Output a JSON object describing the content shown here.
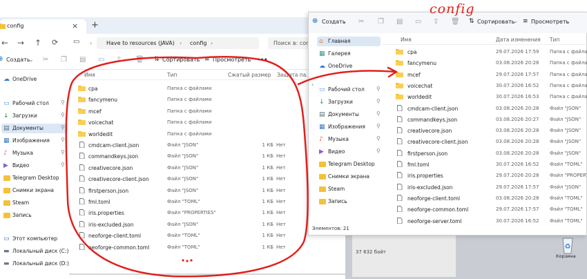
{
  "annotation": "config",
  "left": {
    "tab_title": "config",
    "breadcrumb": [
      "Have to resources (JAVA)",
      "config"
    ],
    "search_placeholder": "Поиск в: config",
    "toolbar": {
      "create": "Создать",
      "sort": "Сортировать",
      "view": "Просмотреть",
      "more": "•••"
    },
    "sidebar": [
      {
        "icon": "onedrive-icon",
        "label": "OneDrive",
        "pinned": false
      },
      {
        "icon": "desktop-icon",
        "label": "Рабочий стол",
        "pinned": true
      },
      {
        "icon": "downloads-icon",
        "label": "Загрузки",
        "pinned": true
      },
      {
        "icon": "documents-icon",
        "label": "Документы",
        "pinned": true
      },
      {
        "icon": "pictures-icon",
        "label": "Изображения",
        "pinned": true
      },
      {
        "icon": "music-icon",
        "label": "Музыка",
        "pinned": true
      },
      {
        "icon": "videos-icon",
        "label": "Видео",
        "pinned": true
      },
      {
        "icon": "folder-icon",
        "label": "Telegram Desktop",
        "pinned": false
      },
      {
        "icon": "folder-icon",
        "label": "Снимки экрана",
        "pinned": false
      },
      {
        "icon": "folder-icon",
        "label": "Steam",
        "pinned": false
      },
      {
        "icon": "folder-icon",
        "label": "Запись",
        "pinned": false
      },
      {
        "icon": "this-pc-icon",
        "label": "Этот компьютер",
        "pinned": false
      },
      {
        "icon": "drive-icon",
        "label": "Локальный диск (C:)",
        "pinned": false
      },
      {
        "icon": "drive-icon",
        "label": "Локальный диск (D:)",
        "pinned": false
      }
    ],
    "columns": {
      "name": "Имя",
      "type": "Тип",
      "size": "Сжатый размер",
      "protected": "Защита па..."
    },
    "files": [
      {
        "name": "cpa",
        "type": "Папка с файлами",
        "size": "",
        "protected": "",
        "kind": "folder"
      },
      {
        "name": "fancymenu",
        "type": "Папка с файлами",
        "size": "",
        "protected": "",
        "kind": "folder"
      },
      {
        "name": "mcef",
        "type": "Папка с файлами",
        "size": "",
        "protected": "",
        "kind": "folder"
      },
      {
        "name": "voicechat",
        "type": "Папка с файлами",
        "size": "",
        "protected": "",
        "kind": "folder"
      },
      {
        "name": "worldedit",
        "type": "Папка с файлами",
        "size": "",
        "protected": "",
        "kind": "folder"
      },
      {
        "name": "cmdcam-client.json",
        "type": "Файл \"JSON\"",
        "size": "1 КБ",
        "protected": "Нет",
        "kind": "file"
      },
      {
        "name": "commandkeys.json",
        "type": "Файл \"JSON\"",
        "size": "1 КБ",
        "protected": "Нет",
        "kind": "file"
      },
      {
        "name": "creativecore.json",
        "type": "Файл \"JSON\"",
        "size": "1 КБ",
        "protected": "Нет",
        "kind": "file"
      },
      {
        "name": "creativecore-client.json",
        "type": "Файл \"JSON\"",
        "size": "1 КБ",
        "protected": "Нет",
        "kind": "file"
      },
      {
        "name": "firstperson.json",
        "type": "Файл \"JSON\"",
        "size": "1 КБ",
        "protected": "Нет",
        "kind": "file"
      },
      {
        "name": "fml.toml",
        "type": "Файл \"TOML\"",
        "size": "1 КБ",
        "protected": "Нет",
        "kind": "file"
      },
      {
        "name": "iris.properties",
        "type": "Файл \"PROPERTIES\"",
        "size": "1 КБ",
        "protected": "Нет",
        "kind": "file"
      },
      {
        "name": "iris-excluded.json",
        "type": "Файл \"JSON\"",
        "size": "1 КБ",
        "protected": "Нет",
        "kind": "file"
      },
      {
        "name": "neoforge-client.toml",
        "type": "Файл \"TOML\"",
        "size": "1 КБ",
        "protected": "Нет",
        "kind": "file"
      },
      {
        "name": "neoforge-common.toml",
        "type": "Файл \"TOML\"",
        "size": "1 КБ",
        "protected": "Нет",
        "kind": "file"
      }
    ]
  },
  "right": {
    "toolbar": {
      "create": "Создать",
      "sort": "Сортировать",
      "view": "Просмотреть"
    },
    "sidebar": [
      {
        "icon": "home-icon",
        "label": "Главная",
        "pinned": false,
        "selected": true
      },
      {
        "icon": "gallery-icon",
        "label": "Галерея",
        "pinned": false
      },
      {
        "icon": "onedrive-icon",
        "label": "OneDrive",
        "pinned": false
      },
      {
        "icon": "desktop-icon",
        "label": "Рабочий стол",
        "pinned": true
      },
      {
        "icon": "downloads-icon",
        "label": "Загрузки",
        "pinned": true
      },
      {
        "icon": "documents-icon",
        "label": "Документы",
        "pinned": true
      },
      {
        "icon": "pictures-icon",
        "label": "Изображения",
        "pinned": true
      },
      {
        "icon": "music-icon",
        "label": "Музыка",
        "pinned": true
      },
      {
        "icon": "videos-icon",
        "label": "Видео",
        "pinned": true
      },
      {
        "icon": "folder-icon",
        "label": "Telegram Desktop",
        "pinned": false
      },
      {
        "icon": "folder-icon",
        "label": "Снимки экрана",
        "pinned": false
      },
      {
        "icon": "folder-icon",
        "label": "Steam",
        "pinned": false
      },
      {
        "icon": "folder-icon",
        "label": "Запись",
        "pinned": false
      }
    ],
    "columns": {
      "name": "Имя",
      "date": "Дата изменения",
      "type": "Тип"
    },
    "files": [
      {
        "name": "cpa",
        "date": "29.07.2026 17:59",
        "type": "Папка с файлами",
        "kind": "folder"
      },
      {
        "name": "fancymenu",
        "date": "03.08.2026 20:28",
        "type": "Папка с файлами",
        "kind": "folder"
      },
      {
        "name": "mcef",
        "date": "29.07.2026 17:57",
        "type": "Папка с файлами",
        "kind": "folder"
      },
      {
        "name": "voicechat",
        "date": "30.07.2026 16:52",
        "type": "Папка с файлами",
        "kind": "folder"
      },
      {
        "name": "worldedit",
        "date": "30.07.2026 16:53",
        "type": "Папка с файлами",
        "kind": "folder"
      },
      {
        "name": "cmdcam-client.json",
        "date": "03.08.2026 20:28",
        "type": "Файл \"JSON\"",
        "kind": "file"
      },
      {
        "name": "commandkeys.json",
        "date": "03.08.2026 20:27",
        "type": "Файл \"JSON\"",
        "kind": "file"
      },
      {
        "name": "creativecore.json",
        "date": "03.08.2026 20:28",
        "type": "Файл \"JSON\"",
        "kind": "file"
      },
      {
        "name": "creativecore-client.json",
        "date": "03.08.2026 20:28",
        "type": "Файл \"JSON\"",
        "kind": "file"
      },
      {
        "name": "firstperson.json",
        "date": "03.08.2026 20:28",
        "type": "Файл \"JSON\"",
        "kind": "file"
      },
      {
        "name": "fml.toml",
        "date": "30.07.2026 16:52",
        "type": "Файл \"TOML\"",
        "kind": "file"
      },
      {
        "name": "iris.properties",
        "date": "29.07.2026 20:28",
        "type": "Файл \"PROPERTIE",
        "kind": "file"
      },
      {
        "name": "iris-excluded.json",
        "date": "29.07.2026 17:57",
        "type": "Файл \"JSON\"",
        "kind": "file"
      },
      {
        "name": "neoforge-client.toml",
        "date": "03.08.2026 20:28",
        "type": "Файл \"TOML\"",
        "kind": "file"
      },
      {
        "name": "neoforge-common.toml",
        "date": "29.07.2026 17:57",
        "type": "Файл \"TOML\"",
        "kind": "file"
      },
      {
        "name": "neoforge-server.toml",
        "date": "30.07.2026 16:52",
        "type": "Файл \"TOML\"",
        "kind": "file"
      }
    ],
    "status": "Элементов: 21"
  },
  "background": {
    "size_text": "37 632 байт",
    "recycle_label": "Корзина"
  },
  "colors": {
    "accent": "#0067c0",
    "annotation_red": "#e0201d",
    "folder": "#f4c13a",
    "selected": "#dbe7f5"
  }
}
